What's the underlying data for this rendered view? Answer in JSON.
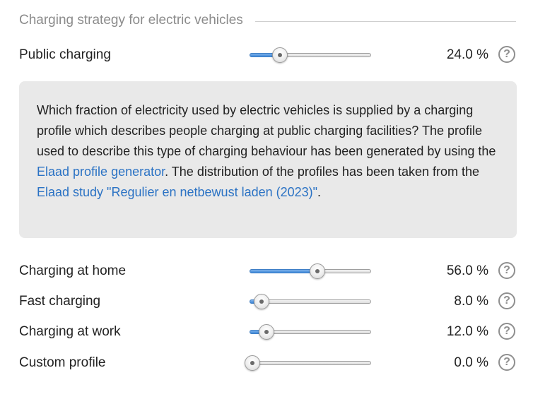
{
  "section": {
    "title": "Charging strategy for electric vehicles"
  },
  "public_charging": {
    "label": "Public charging",
    "value_text": "24.0 %",
    "value_fraction": 0.24,
    "help_icon": "question-circle-icon"
  },
  "info": {
    "text_1": "Which fraction of electricity used by electric vehicles is supplied by a charging profile which describes people charging at public charging facilities? The profile used to describe this type of charging behaviour has been generated by using the ",
    "link_1": "Elaad profile generator",
    "text_2": ". The distribution of the profiles has been taken from the ",
    "link_2": "Elaad study \"Regulier en netbewust laden (2023)\"",
    "text_3": "."
  },
  "rows": [
    {
      "label": "Charging at home",
      "value_text": "56.0 %",
      "value_fraction": 0.56,
      "help_icon": "question-circle-icon"
    },
    {
      "label": "Fast charging",
      "value_text": "8.0 %",
      "value_fraction": 0.08,
      "help_icon": "question-circle-icon"
    },
    {
      "label": "Charging at work",
      "value_text": "12.0 %",
      "value_fraction": 0.12,
      "help_icon": "question-circle-icon"
    },
    {
      "label": "Custom profile",
      "value_text": "0.0 %",
      "value_fraction": 0.0,
      "help_icon": "question-circle-icon"
    }
  ],
  "colors": {
    "accent": "#3c86d8",
    "link": "#2a72c4",
    "info_bg": "#e9e9e9"
  }
}
